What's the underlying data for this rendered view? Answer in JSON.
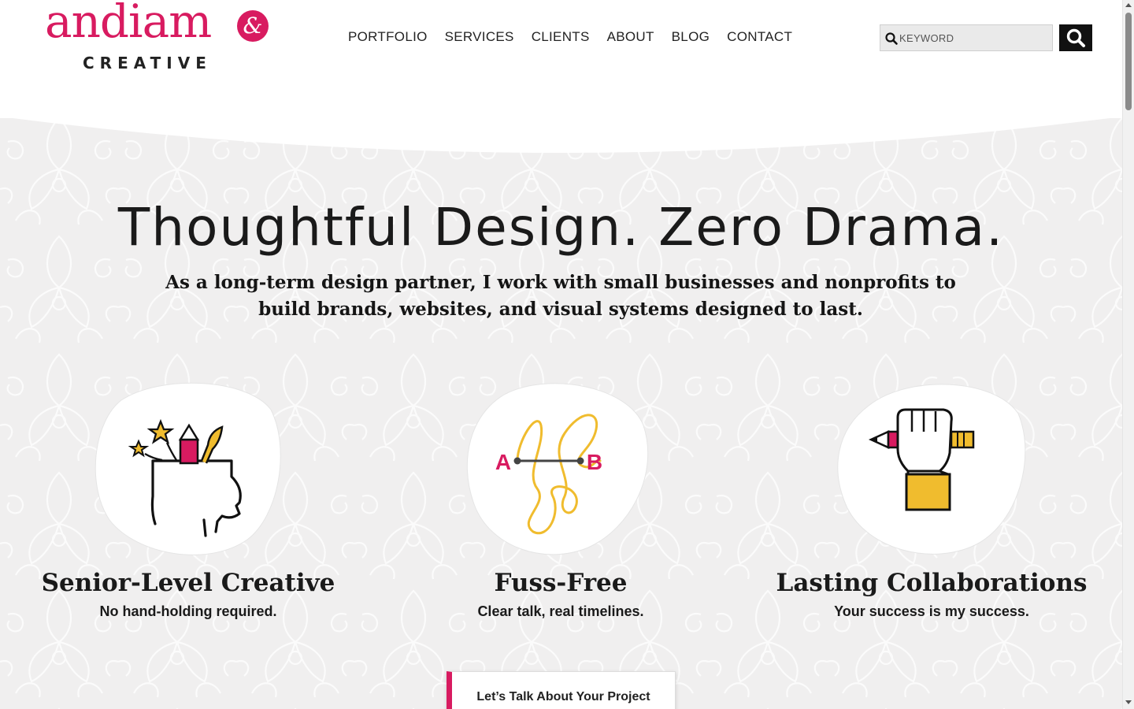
{
  "brand": {
    "logo_word": "andiam",
    "logo_sub": "CREATIVE",
    "accent_color": "#d81b60",
    "gold_color": "#f0bc2e"
  },
  "nav": {
    "items": [
      {
        "label": "PORTFOLIO"
      },
      {
        "label": "SERVICES"
      },
      {
        "label": "CLIENTS"
      },
      {
        "label": "ABOUT"
      },
      {
        "label": "BLOG"
      },
      {
        "label": "CONTACT"
      }
    ]
  },
  "search": {
    "placeholder": "KEYWORD",
    "value": ""
  },
  "hero": {
    "headline": "Thoughtful Design. Zero Drama.",
    "subhead": "As a long-term design partner, I work with small businesses and nonprofits to build brands, websites, and visual systems designed to last."
  },
  "features": [
    {
      "title": "Senior-Level Creative",
      "subtitle": "No hand-holding required.",
      "icon": "creative-head-icon"
    },
    {
      "title": "Fuss-Free",
      "subtitle": "Clear talk, real timelines.",
      "icon": "a-to-b-path-icon",
      "label_a": "A",
      "label_b": "B"
    },
    {
      "title": "Lasting Collaborations",
      "subtitle": "Your success is my success.",
      "icon": "fist-pencil-icon"
    }
  ],
  "cta": {
    "label": "Let’s Talk About Your Project"
  }
}
